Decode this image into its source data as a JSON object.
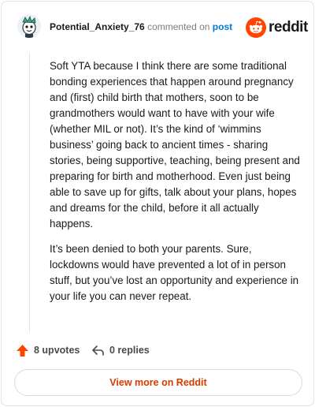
{
  "comment": {
    "username": "Potential_Anxiety_76",
    "action_text": "commented on",
    "post_link": "post",
    "paragraphs": [
      "Soft YTA because I think there are some traditional bonding experiences that happen around pregnancy and (first) child birth that mothers, soon to be grandmothers would want to have with your wife (whether MIL or not). It’s the kind of ‘wimmins business’ going back to ancient times - sharing stories, being supportive, teaching, being present and preparing for birth and motherhood. Even just being able to save up for gifts, talk about your plans, hopes and dreams for the child, before it all actually happens.",
      "It’s been denied to both your parents. Sure, lockdowns would have prevented a lot of in person stuff, but you’ve lost an opportunity and experience in your life you can never repeat."
    ]
  },
  "brand": {
    "wordmark": "reddit",
    "icon": "reddit-snoo-icon",
    "color": "#ff4500"
  },
  "actions": {
    "upvotes": "8 upvotes",
    "upvote_icon": "upvote-arrow-icon",
    "upvote_color": "#ff4500",
    "replies": "0 replies",
    "reply_icon": "reply-arrow-icon"
  },
  "view_more": {
    "label": "View more on Reddit",
    "color": "#d93a00"
  },
  "colors": {
    "link": "#0079d3",
    "muted": "#7c7c7c"
  }
}
